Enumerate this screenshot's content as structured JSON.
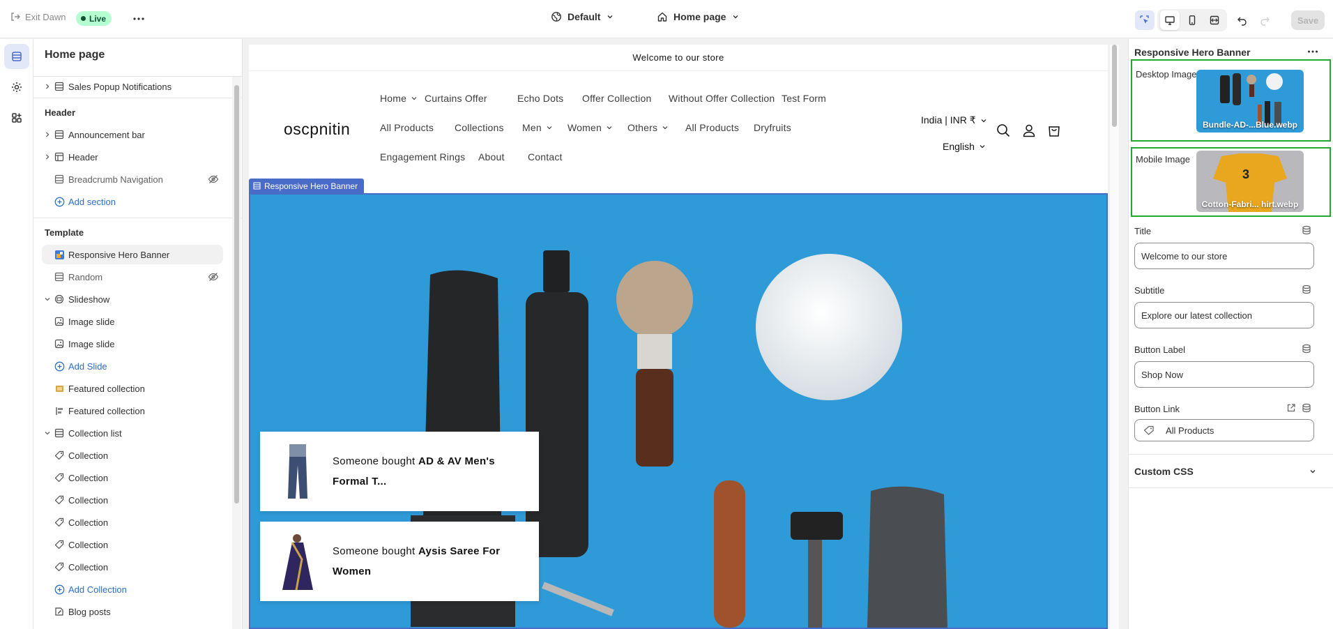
{
  "topbar": {
    "exit_label": "Exit Dawn",
    "live_label": "Live",
    "theme_label": "Default",
    "page_label": "Home page",
    "save_label": "Save"
  },
  "left_panel": {
    "title": "Home page",
    "top_items": [
      {
        "label": "Sales Popup Notifications"
      }
    ],
    "header_heading": "Header",
    "header_items": [
      {
        "label": "Announcement bar"
      },
      {
        "label": "Header"
      },
      {
        "label": "Breadcrumb Navigation"
      }
    ],
    "header_add": "Add section",
    "template_heading": "Template",
    "template_items": [
      {
        "label": "Responsive Hero Banner"
      },
      {
        "label": "Random"
      },
      {
        "label": "Slideshow"
      },
      {
        "label": "Image slide"
      },
      {
        "label": "Image slide"
      },
      {
        "label": "Add Slide"
      },
      {
        "label": "Featured collection"
      },
      {
        "label": "Featured collection"
      },
      {
        "label": "Collection list"
      },
      {
        "label": "Collection"
      },
      {
        "label": "Collection"
      },
      {
        "label": "Collection"
      },
      {
        "label": "Collection"
      },
      {
        "label": "Collection"
      },
      {
        "label": "Collection"
      },
      {
        "label": "Add Collection"
      },
      {
        "label": "Blog posts"
      }
    ]
  },
  "store": {
    "announcement": "Welcome to our store",
    "logo": "oscpnitin",
    "nav_row1": [
      "Home",
      "Curtains Offer",
      "Echo Dots",
      "Offer Collection",
      "Without Offer Collection",
      "Test Form"
    ],
    "nav_row2": [
      "All Products",
      "Collections",
      "Men",
      "Women",
      "Others",
      "All Products",
      "Dryfruits"
    ],
    "nav_row3": [
      "Engagement Rings",
      "About",
      "Contact"
    ],
    "country": "India | INR ₹",
    "language": "English",
    "section_tag": "Responsive Hero Banner",
    "popups": [
      {
        "prefix": "Someone bought ",
        "product": "AD & AV Men's",
        "product_line2": "Formal T..."
      },
      {
        "prefix": "Someone bought ",
        "product": "Aysis Saree For",
        "product_line2": "Women"
      }
    ]
  },
  "right_panel": {
    "title": "Responsive Hero Banner",
    "desktop_image_label": "Desktop Image",
    "desktop_image_file": "Bundle-AD-...Blue.webp",
    "mobile_image_label": "Mobile Image",
    "mobile_image_file": "Cotton-Fabri... hirt.webp",
    "title_label": "Title",
    "title_value": "Welcome to our store",
    "subtitle_label": "Subtitle",
    "subtitle_value": "Explore our latest collection",
    "button_label_label": "Button Label",
    "button_label_value": "Shop Now",
    "button_link_label": "Button Link",
    "button_link_value": "All Products",
    "custom_css_label": "Custom CSS"
  },
  "colors": {
    "accent": "#4a6cc9",
    "hero_bg": "#2f9ad8",
    "highlight_border": "#22a82d",
    "live_bg": "#b4fed2",
    "link_blue": "#2c6ecb"
  }
}
